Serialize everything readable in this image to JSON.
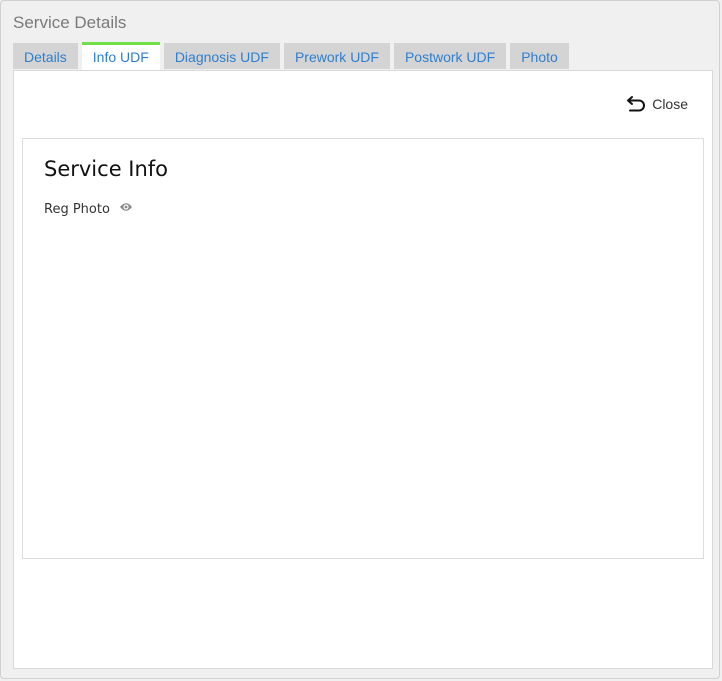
{
  "dialog": {
    "title": "Service Details"
  },
  "tabs": [
    {
      "label": "Details",
      "active": false
    },
    {
      "label": "Info UDF",
      "active": true
    },
    {
      "label": "Diagnosis UDF",
      "active": false
    },
    {
      "label": "Prework UDF",
      "active": false
    },
    {
      "label": "Postwork UDF",
      "active": false
    },
    {
      "label": "Photo",
      "active": false
    }
  ],
  "actions": {
    "close_label": "Close",
    "close_icon": "undo-arrow-icon"
  },
  "section": {
    "title": "Service Info",
    "fields": [
      {
        "label": "Reg Photo",
        "icon": "eye-icon"
      }
    ]
  },
  "colors": {
    "tab_text": "#2f7fd0",
    "active_tab_indicator": "#6fe04a",
    "tab_background": "#d4d4d4"
  }
}
